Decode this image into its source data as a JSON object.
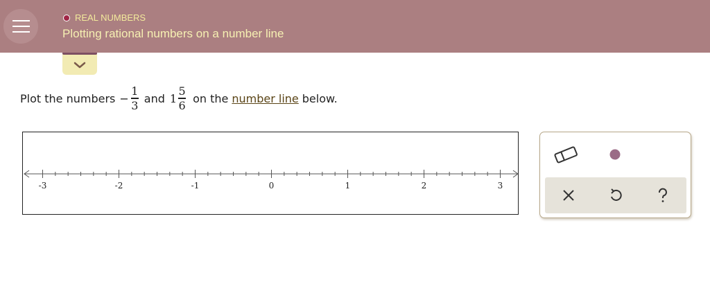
{
  "header": {
    "topic": "REAL NUMBERS",
    "title": "Plotting rational numbers on a number line"
  },
  "question": {
    "prefix": "Plot the numbers",
    "frac1": {
      "sign": "−",
      "numerator": "1",
      "denominator": "3"
    },
    "conj": "and",
    "frac2": {
      "whole": "1",
      "numerator": "5",
      "denominator": "6"
    },
    "mid": "on the",
    "link": "number line",
    "suffix": "below."
  },
  "number_line": {
    "min": -3,
    "max": 3,
    "minor_step": 0.16666666666666666,
    "labels": [
      "-3",
      "-2",
      "-1",
      "0",
      "1",
      "2",
      "3"
    ]
  },
  "tools": {
    "eraser_icon": "eraser-icon",
    "point_icon": "point-icon",
    "clear_icon": "x-icon",
    "undo_icon": "undo-icon",
    "help_icon": "question-icon",
    "point_color": "#9b6b86"
  },
  "colors": {
    "header_bg": "#ab7f81",
    "topic_text": "#f3ea9c",
    "title_text": "#f6f0b2"
  }
}
